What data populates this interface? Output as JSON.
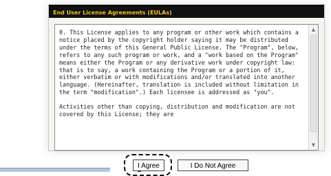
{
  "dialog": {
    "title": "End User License Agreements (EULAs)"
  },
  "license": {
    "paragraph1": "0.  This License applies to any program or other work which contains a notice placed by the copyright holder saying it may be distributed under the terms of this General Public License.  The \"Program\", below, refers to any such program or work, and a \"work based on the Program\" means either the Program or any derivative work under copyright law: that is to say, a work containing the Program or a portion of it, either verbatim or with modifications and/or translated into another language. (Hereinafter, translation is included without limitation in the term \"modification\".) Each licensee is addressed as \"you\".",
    "paragraph2": "Activities other than copying, distribution and modification are not covered by this License; they are"
  },
  "buttons": {
    "agree": "I Agree",
    "disagree": "I Do Not Agree"
  },
  "scrollbar": {
    "up_icon": "scroll-up-arrow",
    "down_icon": "scroll-down-arrow"
  }
}
